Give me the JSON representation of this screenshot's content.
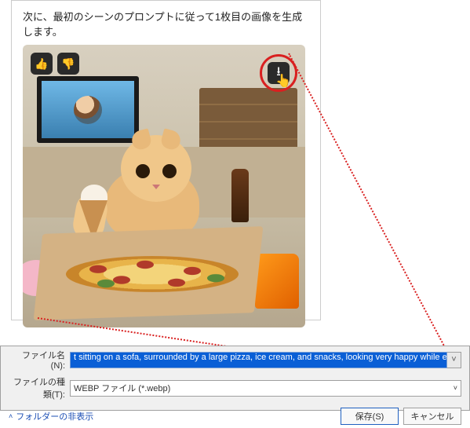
{
  "instruction": "次に、最初のシーンのプロンプトに従って1枚目の画像を生成します。",
  "feedback": {
    "thumbs_up": "👍",
    "thumbs_down": "👎"
  },
  "download": {
    "icon": "⭳"
  },
  "callout": {
    "line_color": "#d92020"
  },
  "dialog": {
    "filename_label": "ファイル名(N):",
    "filename_value": "t sitting on a sofa, surrounded by a large pizza, ice cream, and snacks, looking very happy while eating. The back.webp",
    "filetype_label": "ファイルの種類(T):",
    "filetype_value": "WEBP ファイル (*.webp)",
    "hide_folders": "フォルダーの非表示",
    "save_button": "保存(S)",
    "cancel_button": "キャンセル"
  }
}
